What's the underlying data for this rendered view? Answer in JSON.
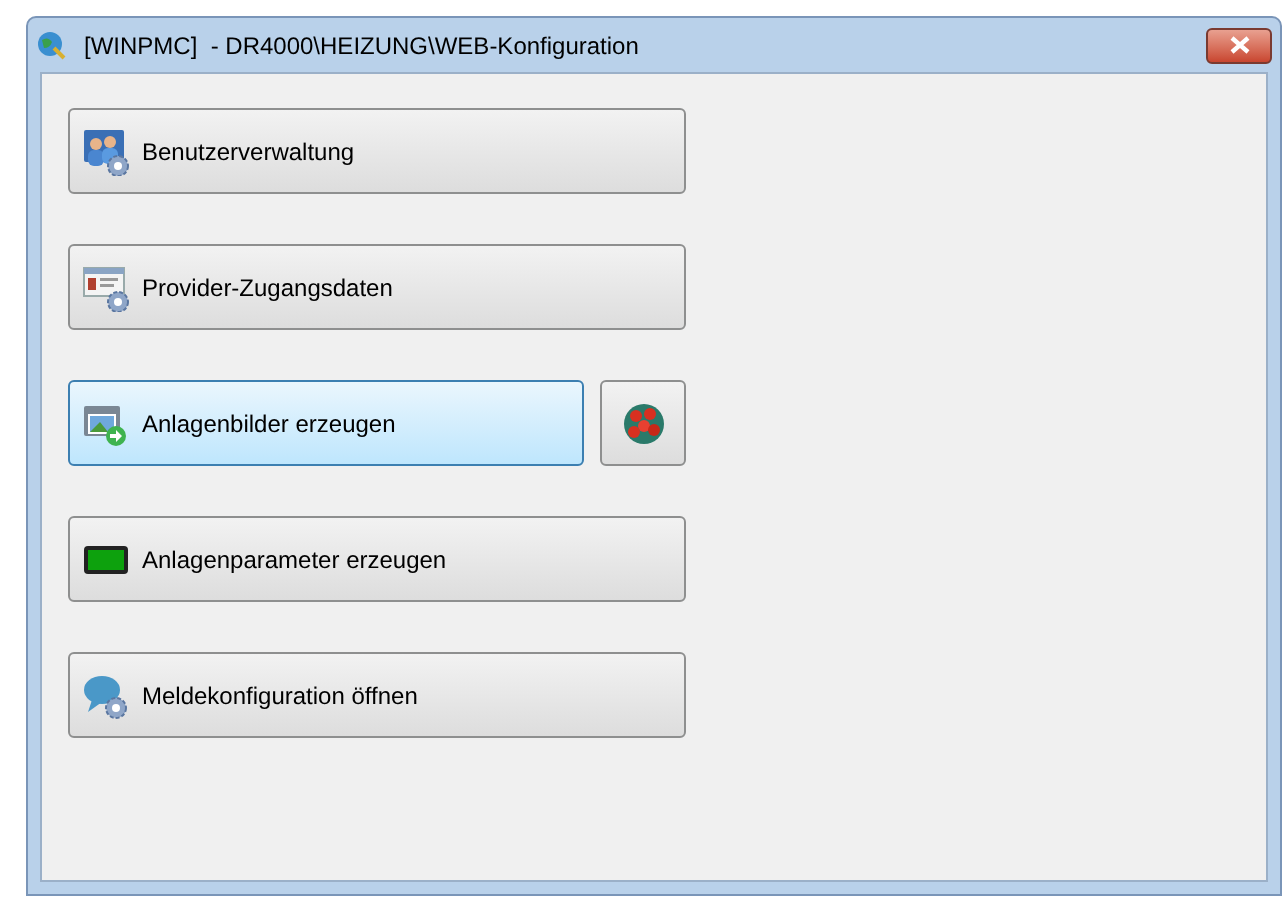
{
  "window": {
    "title": "[WINPMC]  - DR4000\\HEIZUNG\\WEB-Konfiguration"
  },
  "buttons": [
    {
      "label": "Benutzerverwaltung",
      "kind": "users",
      "highlighted": false,
      "side_button": false
    },
    {
      "label": "Provider-Zugangsdaten",
      "kind": "card",
      "highlighted": false,
      "side_button": false
    },
    {
      "label": "Anlagenbilder erzeugen",
      "kind": "image",
      "highlighted": true,
      "side_button": true
    },
    {
      "label": "Anlagenparameter erzeugen",
      "kind": "display",
      "highlighted": false,
      "side_button": false
    },
    {
      "label": "Meldekonfiguration öffnen",
      "kind": "message",
      "highlighted": false,
      "side_button": false
    }
  ]
}
